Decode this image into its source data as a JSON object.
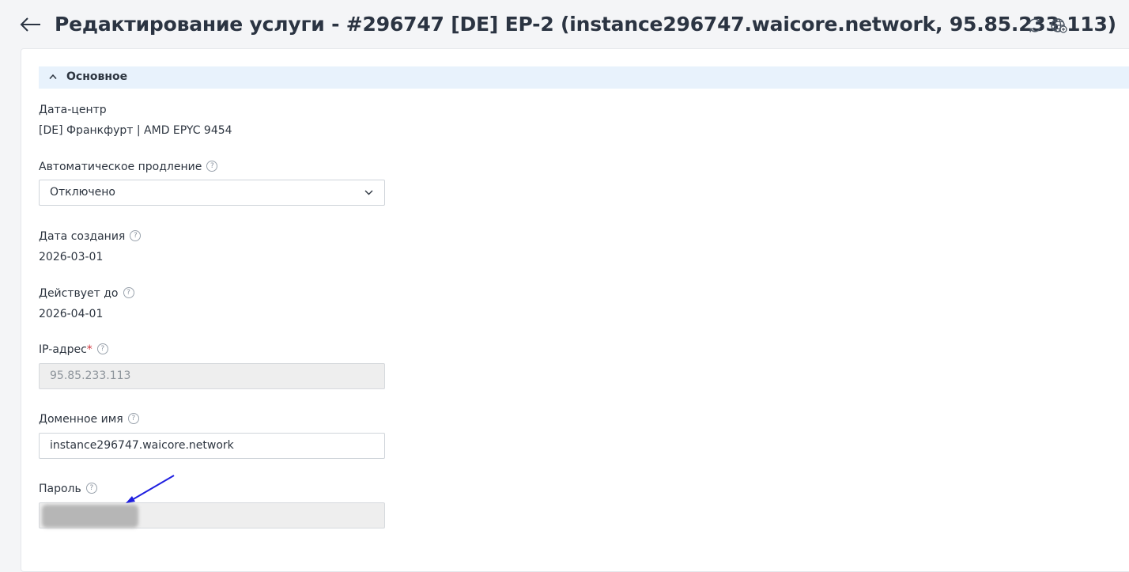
{
  "header": {
    "title": "Редактирование услуги - #296747 [DE] EP-2 (instance296747.waicore.network, 95.85.233.113)",
    "back_icon": "arrow-left-icon",
    "refresh_icon": "refresh-icon",
    "globe_icon": "globe-icon"
  },
  "section": {
    "title": "Основное",
    "expanded": true
  },
  "fields": {
    "datacenter": {
      "label": "Дата-центр",
      "value": "[DE] Франкфурт | AMD EPYC 9454"
    },
    "auto_renew": {
      "label": "Автоматическое продление",
      "help": "?",
      "value": "Отключено"
    },
    "created": {
      "label": "Дата создания",
      "help": "?",
      "value": "2026-03-01"
    },
    "valid_until": {
      "label": "Действует до",
      "help": "?",
      "value": "2026-04-01"
    },
    "ip": {
      "label": "IP-адрес",
      "required": "*",
      "help": "?",
      "value": "95.85.233.113"
    },
    "domain": {
      "label": "Доменное имя",
      "help": "?",
      "value": "instance296747.waicore.network"
    },
    "password": {
      "label": "Пароль",
      "help": "?",
      "value": ""
    }
  },
  "colors": {
    "annotation_arrow": "#1f1fe0",
    "section_bg": "#e8f2fc"
  }
}
